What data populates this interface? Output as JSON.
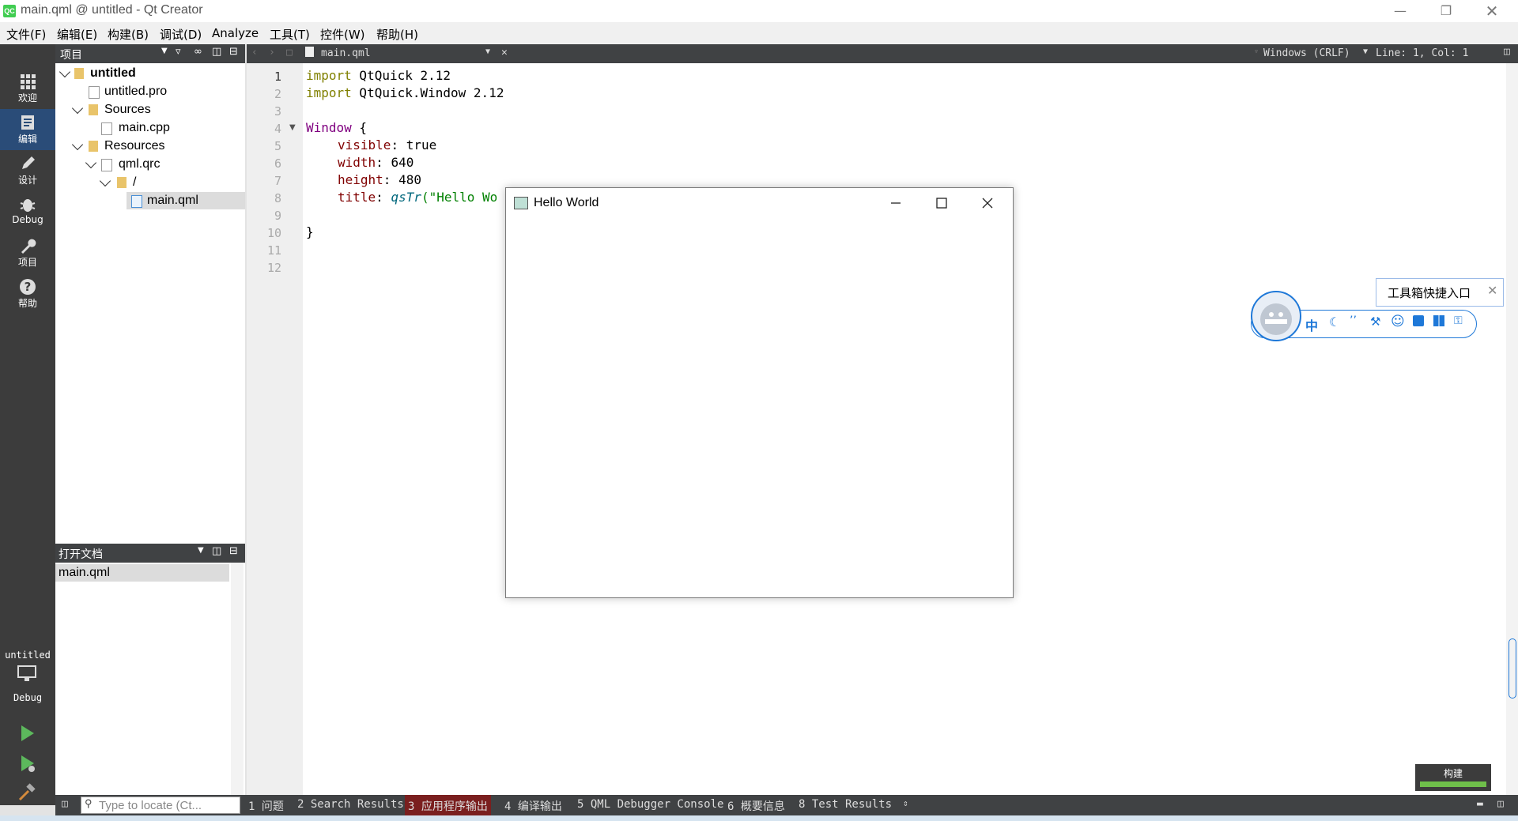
{
  "window": {
    "title": "main.qml @ untitled - Qt Creator",
    "app_icon": "QC"
  },
  "menu": [
    "文件(F)",
    "编辑(E)",
    "构建(B)",
    "调试(D)",
    "Analyze",
    "工具(T)",
    "控件(W)",
    "帮助(H)"
  ],
  "modes": [
    {
      "label": "欢迎",
      "icon": "grid-icon"
    },
    {
      "label": "编辑",
      "icon": "edit-doc-icon"
    },
    {
      "label": "设计",
      "icon": "pencil-icon"
    },
    {
      "label": "Debug",
      "icon": "bug-icon"
    },
    {
      "label": "项目",
      "icon": "wrench-icon"
    },
    {
      "label": "帮助",
      "icon": "help-icon"
    }
  ],
  "kit": {
    "project": "untitled",
    "build": "Debug"
  },
  "projects_panel": {
    "title": "项目",
    "tree": [
      {
        "label": "untitled",
        "bold": true
      },
      {
        "label": "untitled.pro"
      },
      {
        "label": "Sources"
      },
      {
        "label": "main.cpp"
      },
      {
        "label": "Resources"
      },
      {
        "label": "qml.qrc"
      },
      {
        "label": "/"
      },
      {
        "label": "main.qml",
        "selected": true
      }
    ]
  },
  "open_docs": {
    "title": "打开文档",
    "items": [
      "main.qml"
    ]
  },
  "editor": {
    "file": "main.qml",
    "encoding": "Windows (CRLF)",
    "position": "Line: 1, Col: 1",
    "line_numbers": [
      "1",
      "2",
      "3",
      "4",
      "5",
      "6",
      "7",
      "8",
      "9",
      "10",
      "11",
      "12"
    ],
    "code": {
      "l1_kw": "import",
      "l1_rest": " QtQuick 2.12",
      "l2_kw": "import",
      "l2_rest": " QtQuick.Window 2.12",
      "l4_type": "Window",
      "l4_rest": " {",
      "l5_prop": "visible",
      "l5_rest": ": true",
      "l6_prop": "width",
      "l6_rest": ": 640",
      "l7_prop": "height",
      "l7_rest": ": 480",
      "l8_prop": "title",
      "l8_mid": ": ",
      "l8_fn": "qsTr",
      "l8_rest": "(\"Hello Wo",
      "l10": "}"
    }
  },
  "hello_window": {
    "title": "Hello World"
  },
  "ime": {
    "tooltip": "工具箱快捷入口",
    "lang": "中"
  },
  "bottom_panes": [
    "1 问题",
    "2 Search Results",
    "3 应用程序输出",
    "4 编译输出",
    "5 QML Debugger Console",
    "6 概要信息",
    "8 Test Results"
  ],
  "locator": {
    "placeholder": "Type to locate (Ct..."
  },
  "build_progress": {
    "label": "构建",
    "fraction": 1.0,
    "color": "#6fbf4a"
  }
}
